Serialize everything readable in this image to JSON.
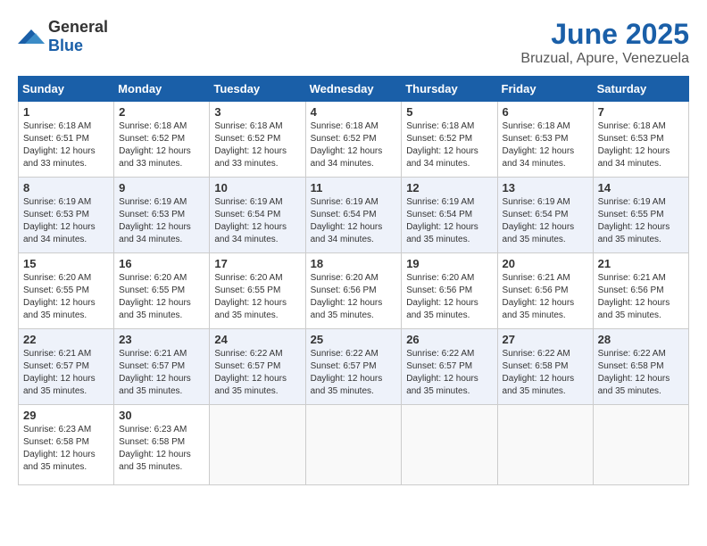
{
  "logo": {
    "general": "General",
    "blue": "Blue"
  },
  "title": {
    "month": "June 2025",
    "location": "Bruzual, Apure, Venezuela"
  },
  "headers": [
    "Sunday",
    "Monday",
    "Tuesday",
    "Wednesday",
    "Thursday",
    "Friday",
    "Saturday"
  ],
  "weeks": [
    [
      {
        "day": "1",
        "sunrise": "6:18 AM",
        "sunset": "6:51 PM",
        "daylight": "12 hours and 33 minutes."
      },
      {
        "day": "2",
        "sunrise": "6:18 AM",
        "sunset": "6:52 PM",
        "daylight": "12 hours and 33 minutes."
      },
      {
        "day": "3",
        "sunrise": "6:18 AM",
        "sunset": "6:52 PM",
        "daylight": "12 hours and 33 minutes."
      },
      {
        "day": "4",
        "sunrise": "6:18 AM",
        "sunset": "6:52 PM",
        "daylight": "12 hours and 34 minutes."
      },
      {
        "day": "5",
        "sunrise": "6:18 AM",
        "sunset": "6:52 PM",
        "daylight": "12 hours and 34 minutes."
      },
      {
        "day": "6",
        "sunrise": "6:18 AM",
        "sunset": "6:53 PM",
        "daylight": "12 hours and 34 minutes."
      },
      {
        "day": "7",
        "sunrise": "6:18 AM",
        "sunset": "6:53 PM",
        "daylight": "12 hours and 34 minutes."
      }
    ],
    [
      {
        "day": "8",
        "sunrise": "6:19 AM",
        "sunset": "6:53 PM",
        "daylight": "12 hours and 34 minutes."
      },
      {
        "day": "9",
        "sunrise": "6:19 AM",
        "sunset": "6:53 PM",
        "daylight": "12 hours and 34 minutes."
      },
      {
        "day": "10",
        "sunrise": "6:19 AM",
        "sunset": "6:54 PM",
        "daylight": "12 hours and 34 minutes."
      },
      {
        "day": "11",
        "sunrise": "6:19 AM",
        "sunset": "6:54 PM",
        "daylight": "12 hours and 34 minutes."
      },
      {
        "day": "12",
        "sunrise": "6:19 AM",
        "sunset": "6:54 PM",
        "daylight": "12 hours and 35 minutes."
      },
      {
        "day": "13",
        "sunrise": "6:19 AM",
        "sunset": "6:54 PM",
        "daylight": "12 hours and 35 minutes."
      },
      {
        "day": "14",
        "sunrise": "6:19 AM",
        "sunset": "6:55 PM",
        "daylight": "12 hours and 35 minutes."
      }
    ],
    [
      {
        "day": "15",
        "sunrise": "6:20 AM",
        "sunset": "6:55 PM",
        "daylight": "12 hours and 35 minutes."
      },
      {
        "day": "16",
        "sunrise": "6:20 AM",
        "sunset": "6:55 PM",
        "daylight": "12 hours and 35 minutes."
      },
      {
        "day": "17",
        "sunrise": "6:20 AM",
        "sunset": "6:55 PM",
        "daylight": "12 hours and 35 minutes."
      },
      {
        "day": "18",
        "sunrise": "6:20 AM",
        "sunset": "6:56 PM",
        "daylight": "12 hours and 35 minutes."
      },
      {
        "day": "19",
        "sunrise": "6:20 AM",
        "sunset": "6:56 PM",
        "daylight": "12 hours and 35 minutes."
      },
      {
        "day": "20",
        "sunrise": "6:21 AM",
        "sunset": "6:56 PM",
        "daylight": "12 hours and 35 minutes."
      },
      {
        "day": "21",
        "sunrise": "6:21 AM",
        "sunset": "6:56 PM",
        "daylight": "12 hours and 35 minutes."
      }
    ],
    [
      {
        "day": "22",
        "sunrise": "6:21 AM",
        "sunset": "6:57 PM",
        "daylight": "12 hours and 35 minutes."
      },
      {
        "day": "23",
        "sunrise": "6:21 AM",
        "sunset": "6:57 PM",
        "daylight": "12 hours and 35 minutes."
      },
      {
        "day": "24",
        "sunrise": "6:22 AM",
        "sunset": "6:57 PM",
        "daylight": "12 hours and 35 minutes."
      },
      {
        "day": "25",
        "sunrise": "6:22 AM",
        "sunset": "6:57 PM",
        "daylight": "12 hours and 35 minutes."
      },
      {
        "day": "26",
        "sunrise": "6:22 AM",
        "sunset": "6:57 PM",
        "daylight": "12 hours and 35 minutes."
      },
      {
        "day": "27",
        "sunrise": "6:22 AM",
        "sunset": "6:58 PM",
        "daylight": "12 hours and 35 minutes."
      },
      {
        "day": "28",
        "sunrise": "6:22 AM",
        "sunset": "6:58 PM",
        "daylight": "12 hours and 35 minutes."
      }
    ],
    [
      {
        "day": "29",
        "sunrise": "6:23 AM",
        "sunset": "6:58 PM",
        "daylight": "12 hours and 35 minutes."
      },
      {
        "day": "30",
        "sunrise": "6:23 AM",
        "sunset": "6:58 PM",
        "daylight": "12 hours and 35 minutes."
      },
      null,
      null,
      null,
      null,
      null
    ]
  ]
}
